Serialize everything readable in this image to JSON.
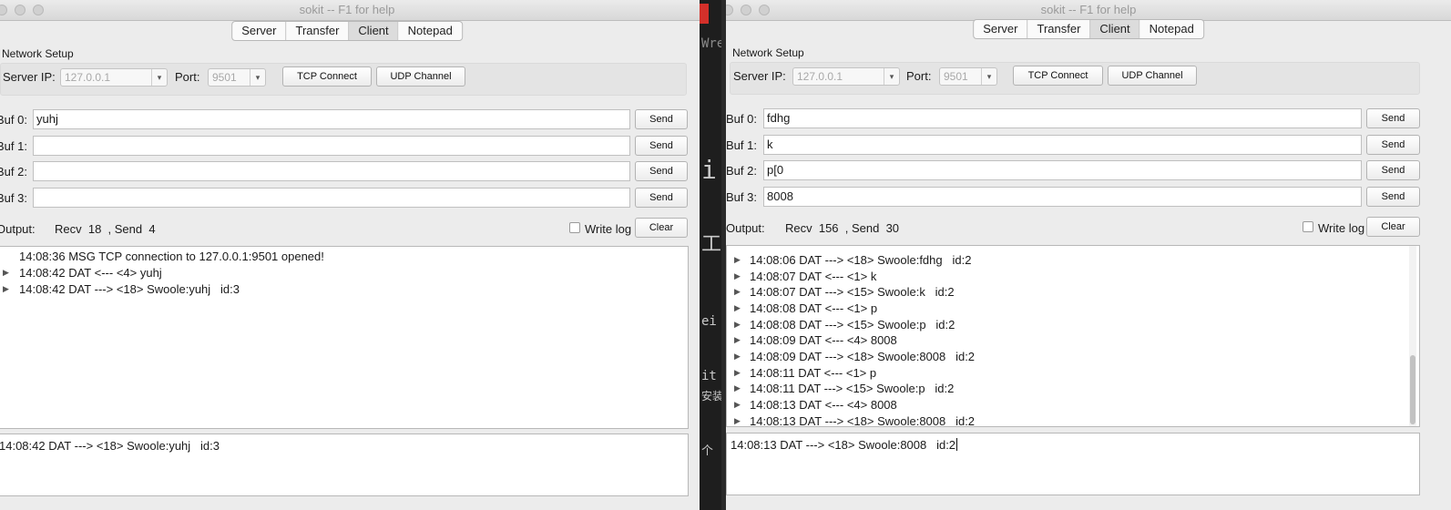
{
  "background_app": {
    "glyphs": [
      "Wre",
      "i",
      "工",
      "ei",
      "it",
      "安装",
      "个"
    ]
  },
  "left": {
    "title": "sokit -- F1 for help",
    "tabs": [
      {
        "label": "Server"
      },
      {
        "label": "Transfer"
      },
      {
        "label": "Client",
        "active": true
      },
      {
        "label": "Notepad"
      }
    ],
    "network_setup_label": "Network Setup",
    "server_ip_label": "Server IP:",
    "server_ip_value": "127.0.0.1",
    "port_label": "Port:",
    "port_value": "9501",
    "tcp_connect_label": "TCP Connect",
    "udp_channel_label": "UDP Channel",
    "buffers": [
      {
        "label": "Buf 0:",
        "value": "yuhj",
        "send": "Send"
      },
      {
        "label": "Buf 1:",
        "value": "",
        "send": "Send"
      },
      {
        "label": "Buf 2:",
        "value": "",
        "send": "Send"
      },
      {
        "label": "Buf 3:",
        "value": "",
        "send": "Send"
      }
    ],
    "output_label": "Output:",
    "stats": "Recv  18  , Send  4",
    "write_log_label": "Write log",
    "clear_label": "Clear",
    "log": [
      {
        "text": "14:08:36 MSG TCP connection to 127.0.0.1:9501 opened!",
        "expandable": false
      },
      {
        "text": "14:08:42 DAT <--- <4> yuhj",
        "expandable": true
      },
      {
        "text": "14:08:42 DAT ---> <18> Swoole:yuhj   id:3",
        "expandable": true
      }
    ],
    "detail_text": "14:08:42 DAT ---> <18> Swoole:yuhj   id:3"
  },
  "right": {
    "title": "sokit -- F1 for help",
    "tabs": [
      {
        "label": "Server"
      },
      {
        "label": "Transfer"
      },
      {
        "label": "Client",
        "active": true
      },
      {
        "label": "Notepad"
      }
    ],
    "network_setup_label": "Network Setup",
    "server_ip_label": "Server IP:",
    "server_ip_value": "127.0.0.1",
    "port_label": "Port:",
    "port_value": "9501",
    "tcp_connect_label": "TCP Connect",
    "udp_channel_label": "UDP Channel",
    "buffers": [
      {
        "label": "Buf 0:",
        "value": "fdhg",
        "send": "Send"
      },
      {
        "label": "Buf 1:",
        "value": "k",
        "send": "Send"
      },
      {
        "label": "Buf 2:",
        "value": "p[0",
        "send": "Send"
      },
      {
        "label": "Buf 3:",
        "value": "8008",
        "send": "Send"
      }
    ],
    "output_label": "Output:",
    "stats": "Recv  156  , Send  30",
    "write_log_label": "Write log",
    "clear_label": "Clear",
    "log": [
      {
        "text": "14:08:06 DAT ---> <18> Swoole:fdhg   id:2",
        "expandable": true
      },
      {
        "text": "14:08:07 DAT <--- <1> k",
        "expandable": true
      },
      {
        "text": "14:08:07 DAT ---> <15> Swoole:k   id:2",
        "expandable": true
      },
      {
        "text": "14:08:08 DAT <--- <1> p",
        "expandable": true
      },
      {
        "text": "14:08:08 DAT ---> <15> Swoole:p   id:2",
        "expandable": true
      },
      {
        "text": "14:08:09 DAT <--- <4> 8008",
        "expandable": true
      },
      {
        "text": "14:08:09 DAT ---> <18> Swoole:8008   id:2",
        "expandable": true
      },
      {
        "text": "14:08:11 DAT <--- <1> p",
        "expandable": true
      },
      {
        "text": "14:08:11 DAT ---> <15> Swoole:p   id:2",
        "expandable": true
      },
      {
        "text": "14:08:13 DAT <--- <4> 8008",
        "expandable": true
      },
      {
        "text": "14:08:13 DAT ---> <18> Swoole:8008   id:2",
        "expandable": true
      }
    ],
    "detail_text": "14:08:13 DAT ---> <18> Swoole:8008   id:2"
  }
}
